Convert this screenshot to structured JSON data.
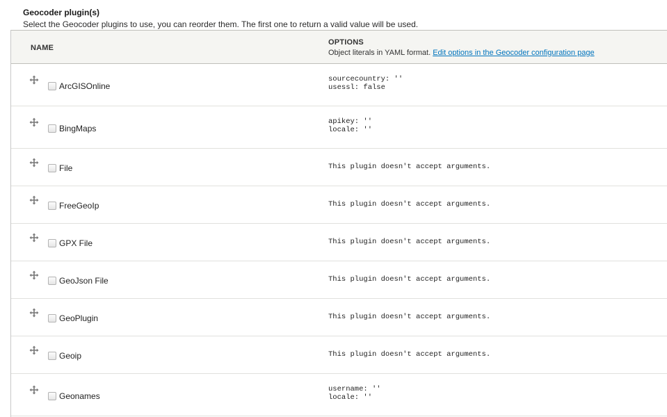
{
  "field": {
    "title": "Geocoder plugin(s)",
    "description": "Select the Geocoder plugins to use, you can reorder them. The first one to return a valid value will be used."
  },
  "table": {
    "header": {
      "name": "NAME",
      "options": "OPTIONS",
      "options_desc": "Object literals in YAML format.",
      "options_link": "Edit options in the Geocoder configuration page"
    },
    "rows": [
      {
        "name": "ArcGISOnline",
        "options": "sourcecountry: ''\nusessl: false",
        "checked": false
      },
      {
        "name": "BingMaps",
        "options": "apikey: ''\nlocale: ''",
        "checked": false
      },
      {
        "name": "File",
        "options": "This plugin doesn't accept arguments.",
        "checked": false
      },
      {
        "name": "FreeGeoIp",
        "options": "This plugin doesn't accept arguments.",
        "checked": false
      },
      {
        "name": "GPX File",
        "options": "This plugin doesn't accept arguments.",
        "checked": false
      },
      {
        "name": "GeoJson File",
        "options": "This plugin doesn't accept arguments.",
        "checked": false
      },
      {
        "name": "GeoPlugin",
        "options": "This plugin doesn't accept arguments.",
        "checked": false
      },
      {
        "name": "Geoip",
        "options": "This plugin doesn't accept arguments.",
        "checked": false
      },
      {
        "name": "Geonames",
        "options": "username: ''\nlocale: ''",
        "checked": false
      }
    ]
  },
  "colors": {
    "link": "#0074bd",
    "header_bg": "#f5f5f2",
    "row_border": "#e1e1dd"
  },
  "icons": {
    "drag_handle": "move-arrows-icon",
    "checkbox": "checkbox-unchecked"
  }
}
